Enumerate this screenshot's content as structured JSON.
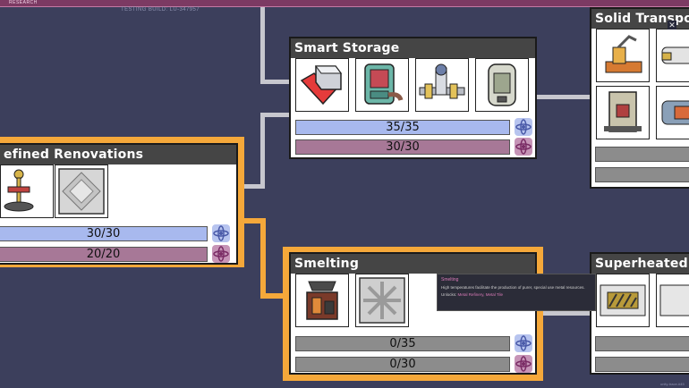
{
  "header": {
    "label": "RESEARCH",
    "build": "TESTING BUILD: LU-347957",
    "close": "✕"
  },
  "cards": {
    "smart_storage": {
      "title": "Smart Storage",
      "bar1": "35/35",
      "bar2": "30/30"
    },
    "refined_renovations": {
      "title": "efined Renovations",
      "bar1": "30/30",
      "bar2": "20/20"
    },
    "smelting": {
      "title": "Smelting",
      "bar1": "0/35",
      "bar2": "0/30"
    },
    "solid_transport": {
      "title": "Solid Transport"
    },
    "superheated_forging": {
      "title": "Superheated Forg"
    }
  },
  "tooltip": {
    "title": "Smelting",
    "body": "High temperatures facilitate the production of purer, special use metal resources.",
    "unlocks_label": "Unlocks:",
    "unlocks_items": "Metal Refinery, Metal Tile"
  },
  "footer": "unity-trace-#45",
  "colors": {
    "background": "#3c3f5c",
    "highlight": "#f5a83a",
    "bar_blue": "#a8b9ee",
    "bar_purple": "#a77897",
    "bar_grey": "#8c8c8c"
  },
  "icons": [
    "storage-locker-icon",
    "refrigerator-icon",
    "gas-valve-icon",
    "smart-tank-icon",
    "pedestal-icon",
    "tile-icon",
    "metal-refinery-icon",
    "metal-tile-icon",
    "conveyor-loader-icon",
    "conveyor-rail-icon",
    "solid-filter-icon",
    "solid-pipe-icon",
    "forge-tile-icon",
    "research-orb-icon"
  ]
}
